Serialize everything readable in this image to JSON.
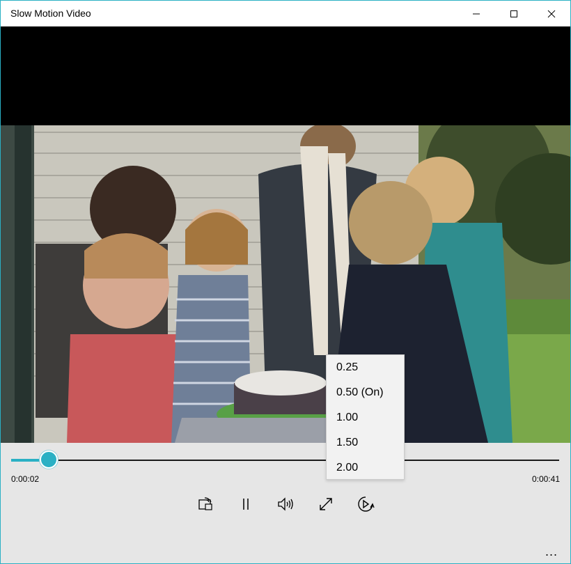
{
  "window": {
    "title": "Slow Motion Video",
    "controls": [
      "minimize-icon",
      "maximize-icon",
      "close-icon"
    ]
  },
  "player": {
    "current_time": "0:00:02",
    "duration": "0:00:41",
    "progress_fraction": 0.068,
    "accent_color": "#2ab0c4",
    "buttons": [
      {
        "name": "cast-to-device-button",
        "icon": "cast-icon"
      },
      {
        "name": "pause-button",
        "icon": "pause-icon"
      },
      {
        "name": "volume-button",
        "icon": "volume-icon"
      },
      {
        "name": "full-screen-button",
        "icon": "expand-icon"
      },
      {
        "name": "playback-speed-button",
        "icon": "speed-icon"
      }
    ],
    "more_label": "..."
  },
  "speed_menu": {
    "items": [
      "0.25",
      "0.50 (On)",
      "1.00",
      "1.50",
      "2.00"
    ],
    "selected_index": 1
  }
}
